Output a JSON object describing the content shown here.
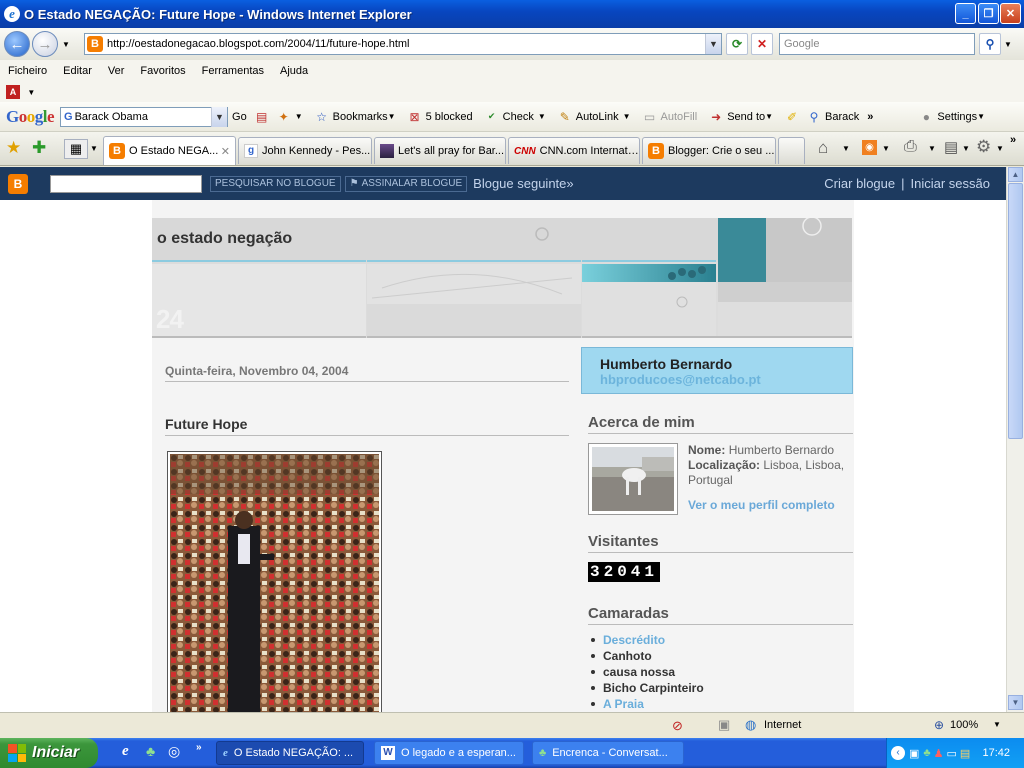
{
  "window": {
    "title": "O Estado NEGAÇÃO: Future Hope - Windows Internet Explorer",
    "minimize_label": "_",
    "maximize_label": "❐",
    "close_label": "✕"
  },
  "address_bar": {
    "url": "http://oestadonegacao.blogspot.com/2004/11/future-hope.html",
    "search_placeholder": "Google"
  },
  "menu": [
    "Ficheiro",
    "Editar",
    "Ver",
    "Favoritos",
    "Ferramentas",
    "Ajuda"
  ],
  "google_toolbar": {
    "logo": "Google",
    "search_value": "Barack Obama",
    "go_label": "Go",
    "bookmarks_label": "Bookmarks",
    "blocked_label": "5 blocked",
    "check_label": "Check",
    "autolink_label": "AutoLink",
    "autofill_label": "AutoFill",
    "sendto_label": "Send to",
    "highlight_label": "Barack",
    "settings_label": "Settings",
    "more_label": "»"
  },
  "tabs": [
    {
      "label": "O Estado NEGA...",
      "active": true,
      "icon": "blogger-icon"
    },
    {
      "label": "John Kennedy - Pes...",
      "active": false,
      "icon": "google-icon"
    },
    {
      "label": "Let's all pray for Bar...",
      "active": false,
      "icon": "image-icon"
    },
    {
      "label": "CNN.com Internatio...",
      "active": false,
      "icon": "cnn-icon"
    },
    {
      "label": "Blogger: Crie o seu ...",
      "active": false,
      "icon": "blogger-icon"
    }
  ],
  "blogger_navbar": {
    "search_button": "PESQUISAR NO BLOGUE",
    "flag_button": "ASSINALAR BLOGUE",
    "next_blog": "Blogue seguinte»",
    "create_blog": "Criar blogue",
    "separator": "|",
    "sign_in": "Iniciar sessão"
  },
  "blog": {
    "title": "o estado negação",
    "header_number": "24",
    "date": "Quinta-feira, Novembro 04, 2004",
    "post_title": "Future Hope"
  },
  "sidebar": {
    "profile_name": "Humberto Bernardo",
    "profile_email": "hbproducoes@netcabo.pt",
    "about_heading": "Acerca de mim",
    "name_label": "Nome:",
    "name_value": "Humberto Bernardo",
    "location_label": "Localização:",
    "location_value": "Lisboa, Lisboa, Portugal",
    "profile_link": "Ver o meu perfil completo",
    "visitors_heading": "Visitantes",
    "visitor_count": "32041",
    "friends_heading": "Camaradas",
    "friends": [
      {
        "label": "Descrédito",
        "color": "#6aaedb"
      },
      {
        "label": "Canhoto",
        "color": "#333333"
      },
      {
        "label": "causa nossa",
        "color": "#333333"
      },
      {
        "label": "Bicho Carpinteiro",
        "color": "#333333"
      },
      {
        "label": "A Praia",
        "color": "#6aaedb"
      }
    ]
  },
  "status_bar": {
    "zone": "Internet",
    "zoom": "100%"
  },
  "taskbar": {
    "start_label": "Iniciar",
    "tasks": [
      {
        "label": "O Estado NEGAÇÃO: ...",
        "active": true,
        "icon": "ie-icon"
      },
      {
        "label": "O legado e a esperan...",
        "active": false,
        "icon": "word-icon"
      },
      {
        "label": "Encrenca - Conversat...",
        "active": false,
        "icon": "messenger-icon"
      }
    ],
    "clock": "17:42"
  },
  "colors": {
    "titlebar": "#0a46c0",
    "blogger_orange": "#f57d00",
    "navbar": "#1d3a5f",
    "profile_box": "#9fd8f0",
    "link_blue": "#6aaedb"
  }
}
